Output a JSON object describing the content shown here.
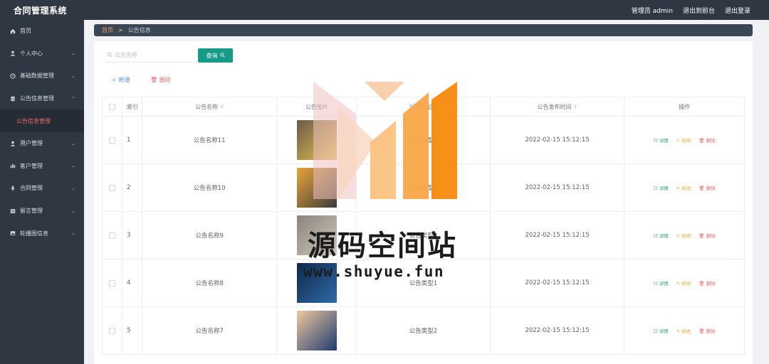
{
  "app": {
    "title": "合同管理系统"
  },
  "topbar": {
    "user": "管理员 admin",
    "back_front": "退出到前台",
    "logout": "退出登录"
  },
  "sidebar": {
    "items": [
      {
        "label": "首页",
        "icon": "home-icon",
        "expandable": false
      },
      {
        "label": "个人中心",
        "icon": "user-icon",
        "expandable": true
      },
      {
        "label": "基础数据管理",
        "icon": "clock-icon",
        "expandable": true
      },
      {
        "label": "公告信息管理",
        "icon": "database-icon",
        "expandable": true,
        "expanded": true
      },
      {
        "label": "公告信息管理",
        "icon": "",
        "sub": true,
        "active": true
      },
      {
        "label": "用户管理",
        "icon": "user-icon",
        "expandable": true
      },
      {
        "label": "客户管理",
        "icon": "bar-chart-icon",
        "expandable": true
      },
      {
        "label": "合同管理",
        "icon": "microphone-icon",
        "expandable": true
      },
      {
        "label": "留言管理",
        "icon": "message-icon",
        "expandable": true
      },
      {
        "label": "轮播图信息",
        "icon": "image-icon",
        "expandable": true
      }
    ]
  },
  "breadcrumb": {
    "home": "首页",
    "separator": ">",
    "current": "公告信息"
  },
  "search": {
    "placeholder": "公告名称",
    "button_label": "查询"
  },
  "actions": {
    "add_label": "新增",
    "delete_label": "删除"
  },
  "table": {
    "headers": {
      "index": "索引",
      "name": "公告名称",
      "picture": "公告图片",
      "type": "公告类型",
      "time": "公告发布时间",
      "ops": "操作"
    },
    "row_ops": {
      "detail": "详情",
      "edit": "修改",
      "delete": "删除"
    },
    "rows": [
      {
        "index": "1",
        "name": "公告名称11",
        "type": "公告类型2",
        "time": "2022-02-15 15:12:15",
        "thumb_colors": [
          "#6b5a4a",
          "#e7c24a"
        ]
      },
      {
        "index": "2",
        "name": "公告名称10",
        "type": "公告类型2",
        "time": "2022-02-15 15:12:15",
        "thumb_colors": [
          "#e8a43a",
          "#3a3a3a"
        ]
      },
      {
        "index": "3",
        "name": "公告名称9",
        "type": "公告类型2",
        "time": "2022-02-15 15:12:15",
        "thumb_colors": [
          "#8a847c",
          "#cfc8be"
        ]
      },
      {
        "index": "4",
        "name": "公告名称8",
        "type": "公告类型1",
        "time": "2022-02-15 15:12:15",
        "thumb_colors": [
          "#0f2848",
          "#2f6aa8"
        ]
      },
      {
        "index": "5",
        "name": "公告名称7",
        "type": "公告类型2",
        "time": "2022-02-15 15:12:15",
        "thumb_colors": [
          "#f0c8a0",
          "#1f3a70"
        ]
      }
    ]
  },
  "watermark": {
    "title": "源码空间站",
    "url": "www.shuyue.fun"
  },
  "colors": {
    "sidebar_bg": "#2f3842",
    "accent_teal": "#179b88",
    "active_menu_text": "#e86b6b",
    "breadcrumb_bg": "#3a4654"
  }
}
